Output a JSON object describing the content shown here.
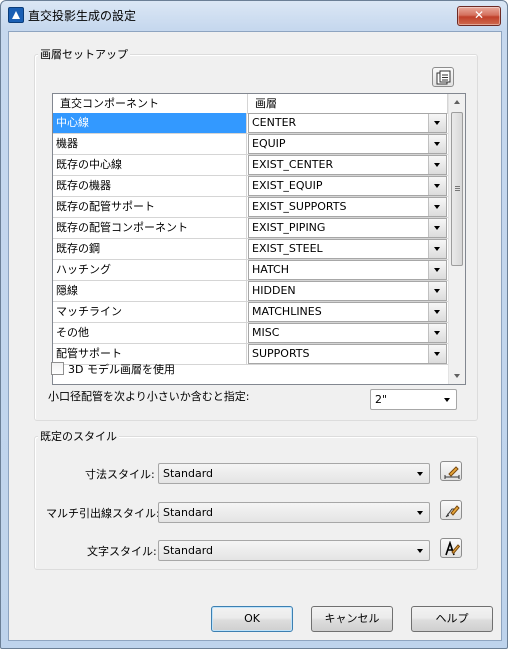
{
  "window": {
    "title": "直交投影生成の設定",
    "close_label": "✕"
  },
  "layer_group": {
    "label": "画層セットアップ",
    "columns": [
      "直交コンポーネント",
      "画層"
    ],
    "rows": [
      {
        "component": "中心線",
        "layer": "CENTER",
        "selected": true
      },
      {
        "component": "機器",
        "layer": "EQUIP"
      },
      {
        "component": "既存の中心線",
        "layer": "EXIST_CENTER"
      },
      {
        "component": "既存の機器",
        "layer": "EXIST_EQUIP"
      },
      {
        "component": "既存の配管サポート",
        "layer": "EXIST_SUPPORTS"
      },
      {
        "component": "既存の配管コンポーネント",
        "layer": "EXIST_PIPING"
      },
      {
        "component": "既存の鋼",
        "layer": "EXIST_STEEL"
      },
      {
        "component": "ハッチング",
        "layer": "HATCH"
      },
      {
        "component": "隠線",
        "layer": "HIDDEN"
      },
      {
        "component": "マッチライン",
        "layer": "MATCHLINES"
      },
      {
        "component": "その他",
        "layer": "MISC"
      },
      {
        "component": "配管サポート",
        "layer": "SUPPORTS"
      }
    ],
    "use_3d_layers_label": "3D モデル画層を使用",
    "use_3d_layers_checked": false,
    "small_bore_label": "小口径配管を次より小さいか含むと指定:",
    "small_bore_value": "2\""
  },
  "style_group": {
    "label": "既定のスタイル",
    "dimension_label": "寸法スタイル:",
    "dimension_value": "Standard",
    "mleader_label": "マルチ引出線スタイル:",
    "mleader_value": "Standard",
    "text_label": "文字スタイル:",
    "text_value": "Standard"
  },
  "buttons": {
    "ok": "OK",
    "cancel": "キャンセル",
    "help": "ヘルプ"
  },
  "icons": {
    "layer_manager": "layer-manager-icon",
    "dimension_style": "dimension-style-icon",
    "mleader_style": "mleader-style-icon",
    "text_style": "text-style-icon"
  }
}
